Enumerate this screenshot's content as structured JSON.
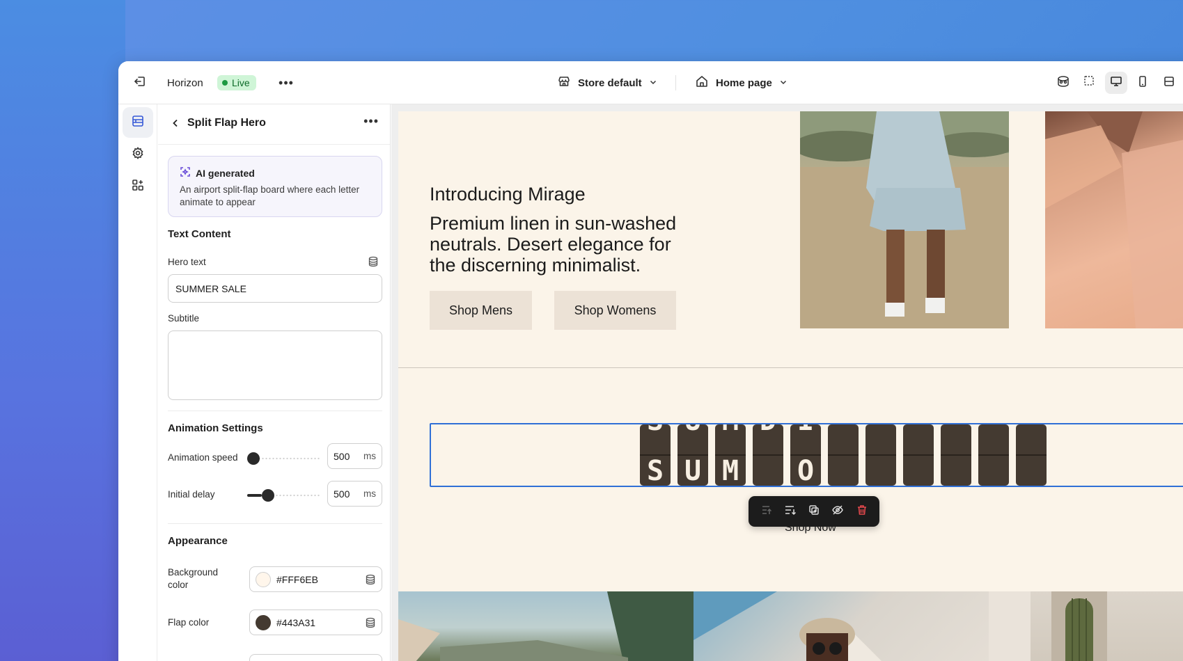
{
  "topbar": {
    "app_name": "Horizon",
    "live_label": "Live",
    "store_label": "Store default",
    "page_label": "Home page"
  },
  "panel": {
    "title": "Split Flap Hero",
    "ai": {
      "title": "AI generated",
      "description": "An airport split-flap board where each letter animate to appear"
    },
    "text_content": {
      "section_title": "Text Content",
      "hero_text_label": "Hero text",
      "hero_text_value": "SUMMER SALE",
      "subtitle_label": "Subtitle",
      "subtitle_value": ""
    },
    "animation": {
      "section_title": "Animation Settings",
      "speed_label": "Animation speed",
      "speed_value": "500",
      "speed_unit": "ms",
      "speed_level": 0.0,
      "delay_label": "Initial delay",
      "delay_value": "500",
      "delay_unit": "ms",
      "delay_level": 0.2
    },
    "appearance": {
      "section_title": "Appearance",
      "bg_label": "Background color",
      "bg_value": "#FFF6EB",
      "flap_label": "Flap color",
      "flap_value": "#443A31"
    }
  },
  "preview": {
    "heading": "Introducing Mirage",
    "copy": "Premium linen in sun-washed neutrals. Desert elegance for the discerning minimalist.",
    "btn_mens": "Shop Mens",
    "btn_womens": "Shop Womens",
    "flaps": [
      {
        "top": "S",
        "bottom": "S"
      },
      {
        "top": "U",
        "bottom": "U"
      },
      {
        "top": "M",
        "bottom": "M"
      },
      {
        "top": "D",
        "bottom": ""
      },
      {
        "top": "I",
        "bottom": "O"
      },
      {
        "top": "",
        "bottom": ""
      },
      {
        "top": "",
        "bottom": ""
      },
      {
        "top": "",
        "bottom": ""
      },
      {
        "top": "",
        "bottom": ""
      },
      {
        "top": "",
        "bottom": ""
      },
      {
        "top": "",
        "bottom": ""
      }
    ],
    "shop_now": "Shop Now"
  },
  "colors": {
    "accent": "#2F6FD6",
    "live_bg": "#CFF5D7",
    "canvas_bg": "#FFF6EB",
    "flap": "#443A31",
    "delete": "#E5484D"
  },
  "icons": {
    "topbar": [
      "exit-icon",
      "store-icon",
      "home-icon",
      "chevron-down-icon",
      "preview-icon",
      "inspector-icon",
      "desktop-icon",
      "mobile-icon",
      "fullscreen-icon"
    ],
    "rail": [
      "sections-icon",
      "settings-icon",
      "apps-icon"
    ],
    "toolbar": [
      "move-up-icon",
      "move-down-icon",
      "duplicate-icon",
      "hide-icon",
      "delete-icon"
    ]
  }
}
